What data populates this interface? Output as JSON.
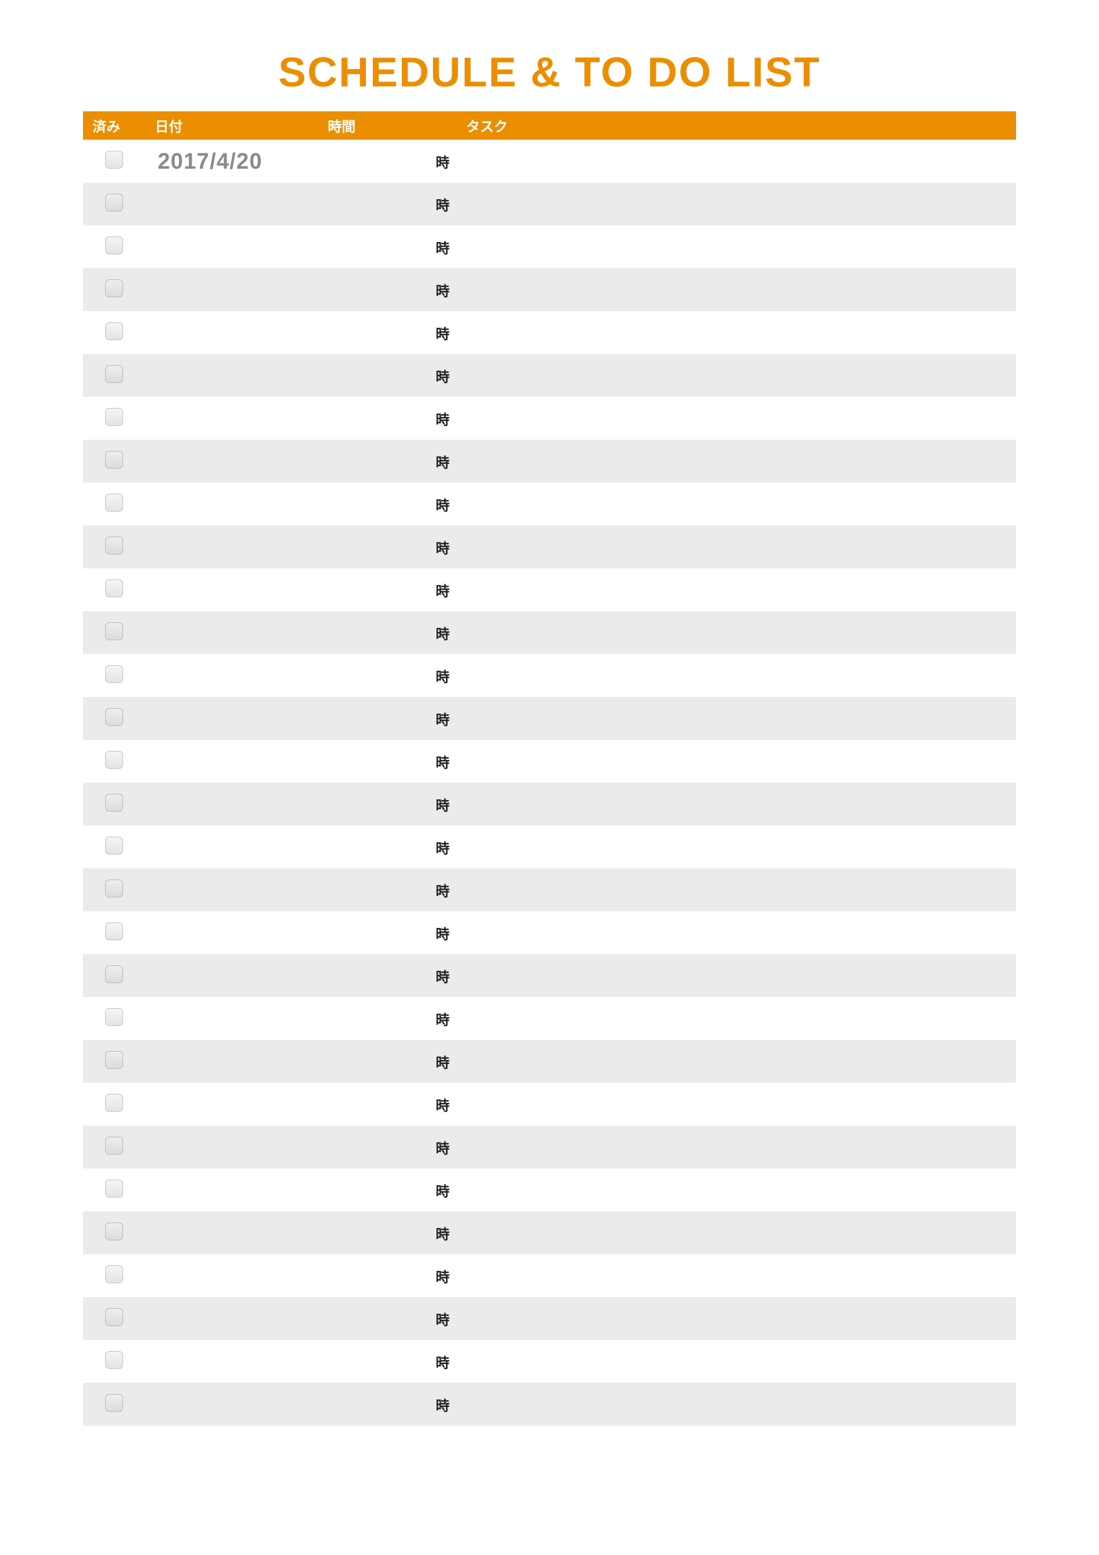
{
  "title": "SCHEDULE & TO DO LIST",
  "columns": {
    "done": "済み",
    "date": "日付",
    "time": "時間",
    "task": "タスク"
  },
  "time_suffix": "時",
  "rows": [
    {
      "done": false,
      "date": "2017/4/20",
      "time": "",
      "task": ""
    },
    {
      "done": false,
      "date": "",
      "time": "",
      "task": ""
    },
    {
      "done": false,
      "date": "",
      "time": "",
      "task": ""
    },
    {
      "done": false,
      "date": "",
      "time": "",
      "task": ""
    },
    {
      "done": false,
      "date": "",
      "time": "",
      "task": ""
    },
    {
      "done": false,
      "date": "",
      "time": "",
      "task": ""
    },
    {
      "done": false,
      "date": "",
      "time": "",
      "task": ""
    },
    {
      "done": false,
      "date": "",
      "time": "",
      "task": ""
    },
    {
      "done": false,
      "date": "",
      "time": "",
      "task": ""
    },
    {
      "done": false,
      "date": "",
      "time": "",
      "task": ""
    },
    {
      "done": false,
      "date": "",
      "time": "",
      "task": ""
    },
    {
      "done": false,
      "date": "",
      "time": "",
      "task": ""
    },
    {
      "done": false,
      "date": "",
      "time": "",
      "task": ""
    },
    {
      "done": false,
      "date": "",
      "time": "",
      "task": ""
    },
    {
      "done": false,
      "date": "",
      "time": "",
      "task": ""
    },
    {
      "done": false,
      "date": "",
      "time": "",
      "task": ""
    },
    {
      "done": false,
      "date": "",
      "time": "",
      "task": ""
    },
    {
      "done": false,
      "date": "",
      "time": "",
      "task": ""
    },
    {
      "done": false,
      "date": "",
      "time": "",
      "task": ""
    },
    {
      "done": false,
      "date": "",
      "time": "",
      "task": ""
    },
    {
      "done": false,
      "date": "",
      "time": "",
      "task": ""
    },
    {
      "done": false,
      "date": "",
      "time": "",
      "task": ""
    },
    {
      "done": false,
      "date": "",
      "time": "",
      "task": ""
    },
    {
      "done": false,
      "date": "",
      "time": "",
      "task": ""
    },
    {
      "done": false,
      "date": "",
      "time": "",
      "task": ""
    },
    {
      "done": false,
      "date": "",
      "time": "",
      "task": ""
    },
    {
      "done": false,
      "date": "",
      "time": "",
      "task": ""
    },
    {
      "done": false,
      "date": "",
      "time": "",
      "task": ""
    },
    {
      "done": false,
      "date": "",
      "time": "",
      "task": ""
    },
    {
      "done": false,
      "date": "",
      "time": "",
      "task": ""
    }
  ]
}
